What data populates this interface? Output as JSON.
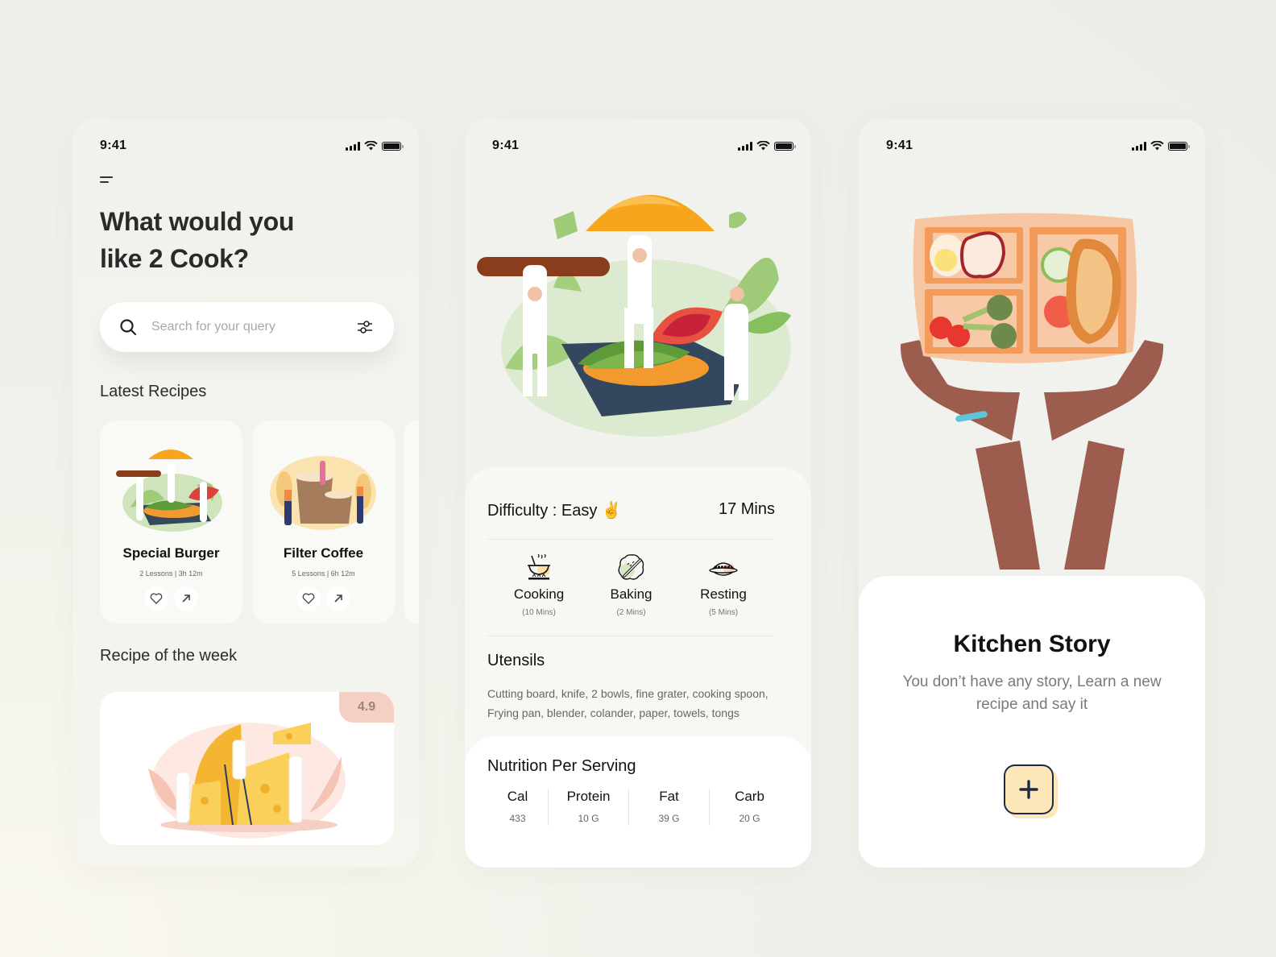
{
  "screens": {
    "home": {
      "status": {
        "time": "9:41"
      },
      "headline_line1": "What would you",
      "headline_line2": "like 2 Cook?",
      "search": {
        "placeholder": "Search for your query",
        "value": ""
      },
      "latest_title": "Latest Recipes",
      "recipes": [
        {
          "name": "Special Burger",
          "meta": "2 Lessons | 3h 12m"
        },
        {
          "name": "Filter Coffee",
          "meta": "5 Lessons | 6h 12m"
        }
      ],
      "week_title": "Recipe of the week",
      "week_rating": "4.9"
    },
    "detail": {
      "status": {
        "time": "9:41"
      },
      "difficulty": "Difficulty : Easy ✌️",
      "total_time": "17 Mins",
      "steps": [
        {
          "label": "Cooking",
          "duration": "(10 Mins)",
          "icon": "cooking-pot-icon"
        },
        {
          "label": "Baking",
          "duration": "(2 Mins)",
          "icon": "rolling-pin-icon"
        },
        {
          "label": "Resting",
          "duration": "(5 Mins)",
          "icon": "plate-icon"
        }
      ],
      "utensils_title": "Utensils",
      "utensils_text": "Cutting board, knife, 2 bowls, fine grater, cooking spoon, Frying pan, blender, colander, paper, towels, tongs",
      "nutrition_title": "Nutrition Per Serving",
      "nutrition": [
        {
          "key": "Cal",
          "value": "433"
        },
        {
          "key": "Protein",
          "value": "10 G"
        },
        {
          "key": "Fat",
          "value": "39 G"
        },
        {
          "key": "Carb",
          "value": "20 G"
        }
      ]
    },
    "story": {
      "status": {
        "time": "9:41"
      },
      "title": "Kitchen Story",
      "subtitle": "You don’t have any story, Learn a new recipe and say it",
      "add_label": "+"
    }
  },
  "colors": {
    "background": "#eef0ea",
    "phone_bg": "#f1f2ed",
    "rating_bg": "#f6cfc4",
    "add_button": "#fde7b8",
    "add_border": "#1c2a45",
    "bun": "#f7a51c",
    "patty": "#8a3d1d",
    "leaf": "#a4cf7e"
  }
}
